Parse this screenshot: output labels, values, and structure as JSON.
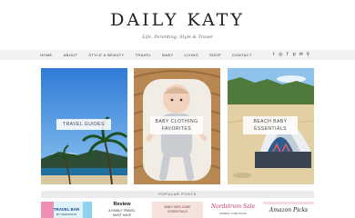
{
  "header": {
    "title": "DAILY KATY",
    "tagline": "Life, Parenting, Style & Travel"
  },
  "nav": {
    "items": [
      "HOME",
      "ABOUT",
      "STYLE & BEAUTY",
      "TRAVEL",
      "BABY",
      "LIVING",
      "SHOP",
      "CONTACT"
    ],
    "icons": [
      {
        "name": "twitter-icon",
        "glyph": "t"
      },
      {
        "name": "instagram-icon",
        "glyph": "◎"
      },
      {
        "name": "facebook-icon",
        "glyph": "f"
      },
      {
        "name": "pinterest-icon",
        "glyph": "p"
      },
      {
        "name": "email-icon",
        "glyph": "✉"
      },
      {
        "name": "search-icon",
        "glyph": "⚲"
      }
    ]
  },
  "features": [
    {
      "label": "TRAVEL GUIDES"
    },
    {
      "label": "BABY CLOTHING\nFAVORITES"
    },
    {
      "label": "BEACH BABY\nESSENTIALS"
    }
  ],
  "popular": {
    "title": "POPULAR POSTS",
    "thumbs": [
      {
        "line1": "TRAVEL BAR",
        "line2": "BY SAMSONITE"
      },
      {
        "line1": "Review",
        "line2": "A FAMILY TRAVEL",
        "line3": "MUST HAVE"
      },
      {
        "line1": "BABY SKIN CARE",
        "line2": "ESSENTIALS"
      },
      {
        "line1": "Nordstrom Sale",
        "line2": "MOMMY & ME PICKS"
      },
      {
        "line1": "Amazon Picks"
      }
    ]
  },
  "colors": {
    "nav_bg": "#f2f2f2",
    "popular_bg": "#ececec",
    "text": "#222222"
  }
}
